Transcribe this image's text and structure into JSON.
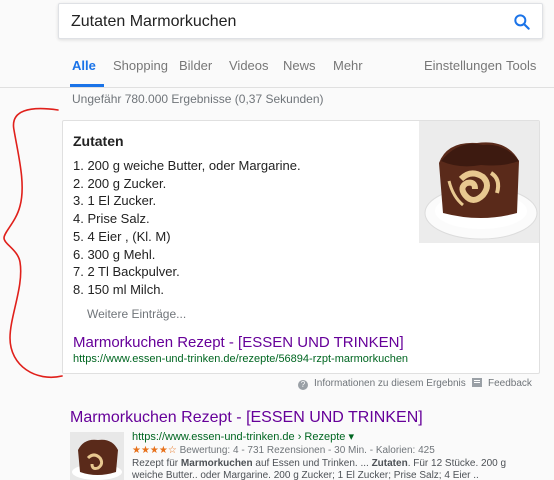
{
  "search": {
    "query": "Zutaten Marmorkuchen"
  },
  "tabs": [
    {
      "label": "Alle",
      "active": true
    },
    {
      "label": "Shopping"
    },
    {
      "label": "Bilder"
    },
    {
      "label": "Videos"
    },
    {
      "label": "News"
    },
    {
      "label": "Mehr"
    },
    {
      "label": "Einstellungen"
    },
    {
      "label": "Tools"
    }
  ],
  "result_stats": "Ungefähr 780.000 Ergebnisse (0,37 Sekunden)",
  "featured": {
    "title": "Zutaten",
    "ingredients": [
      "1. 200 g weiche Butter, oder Margarine.",
      "2. 200 g Zucker.",
      "3. 1 El Zucker.",
      "4. Prise Salz.",
      "5. 4 Eier , (Kl. M)",
      "6. 300 g Mehl.",
      "7. 2 Tl Backpulver.",
      "8. 150 ml Milch."
    ],
    "more": "Weitere Einträge...",
    "link_title": "Marmorkuchen Rezept - [ESSEN UND TRINKEN]",
    "link_url": "https://www.essen-und-trinken.de/rezepte/56894-rzpt-marmorkuchen"
  },
  "info_row": {
    "about": "Informationen zu diesem Ergebnis",
    "feedback": "Feedback"
  },
  "result2": {
    "title": "Marmorkuchen Rezept - [ESSEN UND TRINKEN]",
    "url": "https://www.essen-und-trinken.de › Rezepte ▾",
    "stars": "★★★★☆",
    "rating_meta": "Bewertung: 4 - 731 Rezensionen - 30 Min. - Kalorien: 425",
    "snippet_line1_a": "Rezept für ",
    "snippet_line1_b": "Marmorkuchen",
    "snippet_line1_c": " auf Essen und Trinken. ... ",
    "snippet_line1_d": "Zutaten",
    "snippet_line1_e": ". Für 12 Stücke. 200 g",
    "snippet_line2": "weiche Butter.. oder Margarine. 200 g Zucker; 1 El Zucker; Prise Salz; 4 Eier .."
  },
  "colors": {
    "accent": "#1a73e8",
    "visited_link": "#660099",
    "url_green": "#006621",
    "annotation_red": "#e0201b"
  }
}
